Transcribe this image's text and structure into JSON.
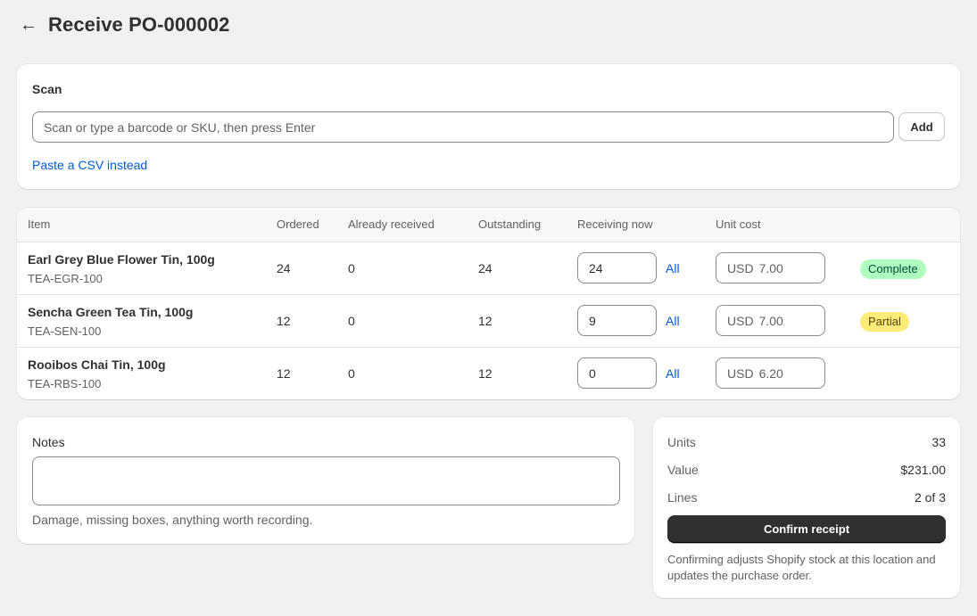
{
  "header": {
    "back_icon": "arrow-left-icon",
    "title": "Receive PO-000002"
  },
  "scan": {
    "title": "Scan",
    "placeholder": "Scan or type a barcode or SKU, then press Enter",
    "add_label": "Add",
    "csv_link": "Paste a CSV instead"
  },
  "table": {
    "headers": [
      "Item",
      "Ordered",
      "Already received",
      "Outstanding",
      "Receiving now",
      "Unit cost"
    ],
    "rows": [
      {
        "name": "Earl Grey Blue Flower Tin, 100g",
        "sku": "TEA-EGR-100",
        "ordered": "24",
        "received": "0",
        "outstanding": "24",
        "receiving": "24",
        "all_label": "All",
        "currency": "USD",
        "cost": "7.00",
        "status": "Complete"
      },
      {
        "name": "Sencha Green Tea Tin, 100g",
        "sku": "TEA-SEN-100",
        "ordered": "12",
        "received": "0",
        "outstanding": "12",
        "receiving": "9",
        "all_label": "All",
        "currency": "USD",
        "cost": "7.00",
        "status": "Partial"
      },
      {
        "name": "Rooibos Chai Tin, 100g",
        "sku": "TEA-RBS-100",
        "ordered": "12",
        "received": "0",
        "outstanding": "12",
        "receiving": "0",
        "all_label": "All",
        "currency": "USD",
        "cost": "6.20",
        "status": ""
      }
    ]
  },
  "notes": {
    "label": "Notes",
    "value": "",
    "help": "Damage, missing boxes, anything worth recording."
  },
  "summary": {
    "units_label": "Units",
    "units_value": "33",
    "value_label": "Value",
    "value_value": "$231.00",
    "lines_label": "Lines",
    "lines_value": "2 of 3",
    "confirm_label": "Confirm receipt",
    "help": "Confirming adjusts Shopify stock at this location and updates the purchase order."
  },
  "colors": {
    "background": "#f1f1f1",
    "link": "#005bd3",
    "primary_button": "#303030",
    "badge_complete": "#affebf",
    "badge_partial": "#ffeb78"
  }
}
